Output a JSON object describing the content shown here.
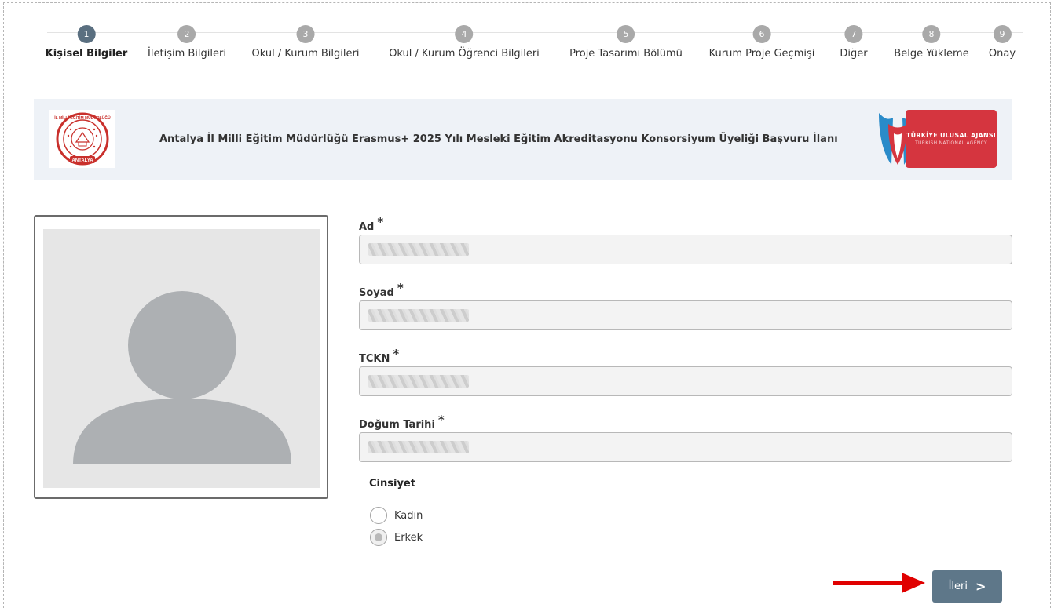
{
  "stepper": {
    "active_step": 1,
    "steps": [
      {
        "number": "1",
        "label": "Kişisel Bilgiler"
      },
      {
        "number": "2",
        "label": "İletişim Bilgileri"
      },
      {
        "number": "3",
        "label": "Okul / Kurum Bilgileri"
      },
      {
        "number": "4",
        "label": "Okul / Kurum Öğrenci Bilgileri"
      },
      {
        "number": "5",
        "label": "Proje Tasarımı Bölümü"
      },
      {
        "number": "6",
        "label": "Kurum Proje Geçmişi"
      },
      {
        "number": "7",
        "label": "Diğer"
      },
      {
        "number": "8",
        "label": "Belge Yükleme"
      },
      {
        "number": "9",
        "label": "Onay"
      }
    ]
  },
  "banner": {
    "title": "Antalya İl Milli Eğitim Müdürlüğü Erasmus+ 2025 Yılı Mesleki Eğitim Akreditasyonu Konsorsiyum Üyeliği Başvuru İlanı",
    "left_logo_text": "İL MİLLİ EĞİTİM MÜDÜRLÜĞÜ",
    "left_logo_city": "ANTALYA",
    "right_logo_name": "TÜRKİYE ULUSAL AJANSI",
    "right_logo_sub": "TURKISH NATIONAL AGENCY"
  },
  "form": {
    "required_mark": "*",
    "fields": [
      {
        "label": "Ad",
        "value": ""
      },
      {
        "label": "Soyad",
        "value": ""
      },
      {
        "label": "TCKN",
        "value": ""
      },
      {
        "label": "Doğum Tarihi",
        "value": ""
      }
    ],
    "gender": {
      "title": "Cinsiyet",
      "options": [
        {
          "label": "Kadın",
          "checked": false
        },
        {
          "label": "Erkek",
          "checked": true
        }
      ]
    }
  },
  "actions": {
    "next_label": "İleri",
    "next_chevron": ">"
  },
  "colors": {
    "step_active": "#5a6f80",
    "step_inactive": "#a9a9a9",
    "next_button": "#5e7789",
    "banner_bg": "#eef2f7",
    "tua_red": "#d5353f",
    "annotation_arrow": "#e00000"
  },
  "icons": {
    "photo_placeholder": "user-silhouette-icon",
    "annotation": "red-arrow-icon",
    "next": "chevron-right-icon"
  }
}
